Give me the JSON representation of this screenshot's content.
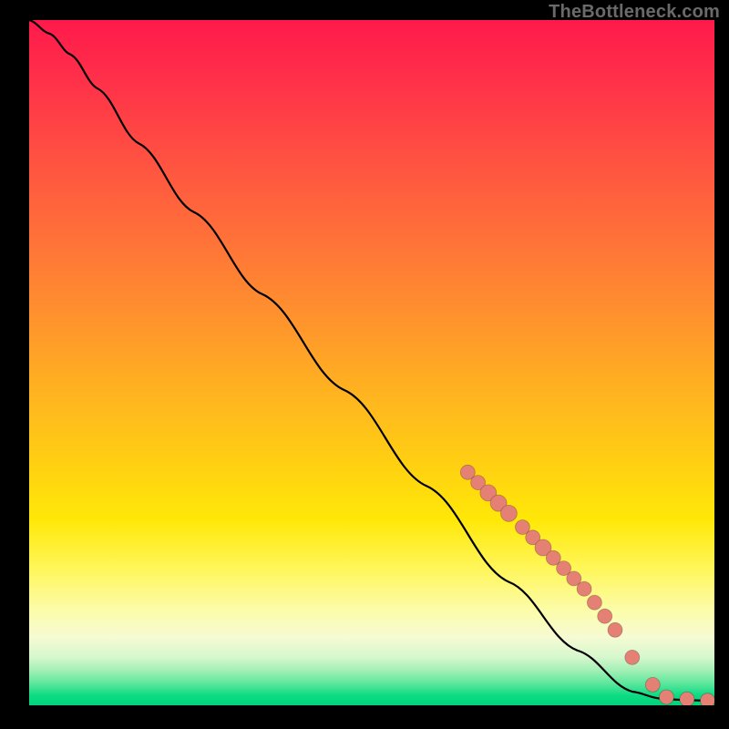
{
  "watermark": "TheBottleneck.com",
  "chart_data": {
    "type": "line",
    "title": "",
    "xlabel": "",
    "ylabel": "",
    "xlim": [
      0,
      100
    ],
    "ylim": [
      0,
      100
    ],
    "grid": false,
    "legend": false,
    "line": {
      "x": [
        0,
        3,
        6,
        10,
        16,
        24,
        34,
        46,
        58,
        70,
        80,
        88,
        92,
        95,
        98,
        100
      ],
      "y": [
        100,
        98,
        95,
        90,
        82,
        72,
        60,
        46,
        32,
        18,
        8,
        2,
        1,
        0.8,
        0.7,
        0.6
      ]
    },
    "dots": {
      "x": [
        64,
        65.5,
        67,
        68.5,
        70,
        72,
        73.5,
        75,
        76.5,
        78,
        79.5,
        81,
        82.5,
        84,
        85.5,
        88,
        91,
        93,
        96,
        99
      ],
      "y": [
        34,
        32.5,
        31,
        29.5,
        28,
        26,
        24.5,
        23,
        21.5,
        20,
        18.5,
        17,
        15,
        13,
        11,
        7,
        3,
        1.2,
        0.9,
        0.7
      ],
      "r": [
        8,
        8,
        9,
        9,
        9,
        8,
        8,
        9,
        8,
        8,
        8,
        8,
        8,
        8,
        8,
        8,
        8,
        8,
        8,
        8
      ]
    },
    "gradient_stops": [
      {
        "pos": 0.0,
        "color": "#ff1a4b"
      },
      {
        "pos": 0.35,
        "color": "#ff7a36"
      },
      {
        "pos": 0.66,
        "color": "#ffd310"
      },
      {
        "pos": 0.86,
        "color": "#fcfca8"
      },
      {
        "pos": 0.95,
        "color": "#a0efb4"
      },
      {
        "pos": 1.0,
        "color": "#00d37a"
      }
    ]
  }
}
